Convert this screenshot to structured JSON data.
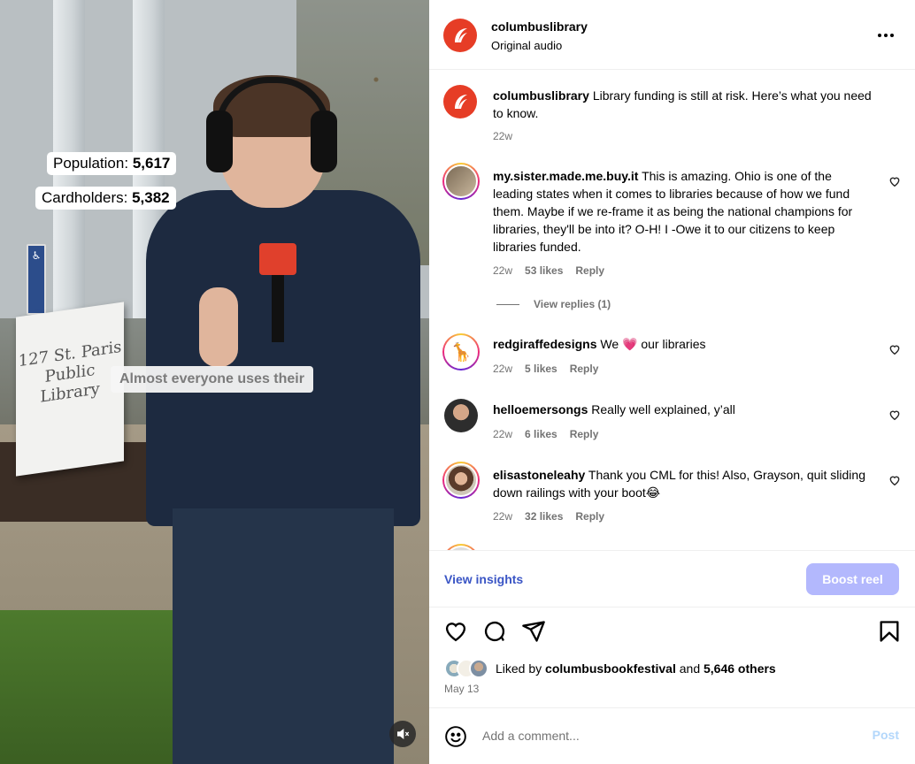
{
  "video": {
    "overlay_population_label": "Population:",
    "overlay_population_value": "5,617",
    "overlay_cardholders_label": "Cardholders:",
    "overlay_cardholders_value": "5,382",
    "caption": "Almost everyone uses their",
    "sign_text": "127 St. Paris Public Library"
  },
  "header": {
    "username": "columbuslibrary",
    "audio": "Original audio"
  },
  "post": {
    "username": "columbuslibrary",
    "text": "Library funding is still at risk. Here’s what you need to know.",
    "time": "22w"
  },
  "comments": [
    {
      "username": "my.sister.made.me.buy.it",
      "text": "This is amazing. Ohio is one of the leading states when it comes to libraries because of how we fund them. Maybe if we re-frame it as being the national champions for libraries, they'll be into it? O-H! I -Owe it to our citizens to keep libraries funded.",
      "time": "22w",
      "likes": "53 likes",
      "reply": "Reply",
      "view_replies": "View replies (1)"
    },
    {
      "username": "redgiraffedesigns",
      "text_before": "We",
      "emoji": "💗",
      "text_after": "our libraries",
      "time": "22w",
      "likes": "5 likes",
      "reply": "Reply"
    },
    {
      "username": "helloemersongs",
      "text": "Really well explained, y’all",
      "time": "22w",
      "likes": "6 likes",
      "reply": "Reply"
    },
    {
      "username": "elisastoneleahy",
      "text": "Thank you CML for this! Also, Grayson, quit sliding down railings with your boot😂",
      "time": "22w",
      "likes": "32 likes",
      "reply": "Reply"
    }
  ],
  "actions": {
    "view_insights": "View insights",
    "boost": "Boost reel"
  },
  "likes": {
    "prefix": "Liked by",
    "user": "columbusbookfestival",
    "middle": "and",
    "others": "5,646 others",
    "date": "May 13"
  },
  "add_comment": {
    "placeholder": "Add a comment...",
    "post": "Post"
  },
  "colors": {
    "brand": "#e63d26",
    "link": "#3a55c5",
    "boost_disabled": "#b3b8fd",
    "post_disabled": "#b3d7fb",
    "meta": "#737373"
  },
  "icons": [
    "more-icon",
    "heart-icon",
    "comment-icon",
    "share-icon",
    "bookmark-icon",
    "emoji-icon",
    "muted-speaker-icon",
    "library-logo-icon"
  ]
}
